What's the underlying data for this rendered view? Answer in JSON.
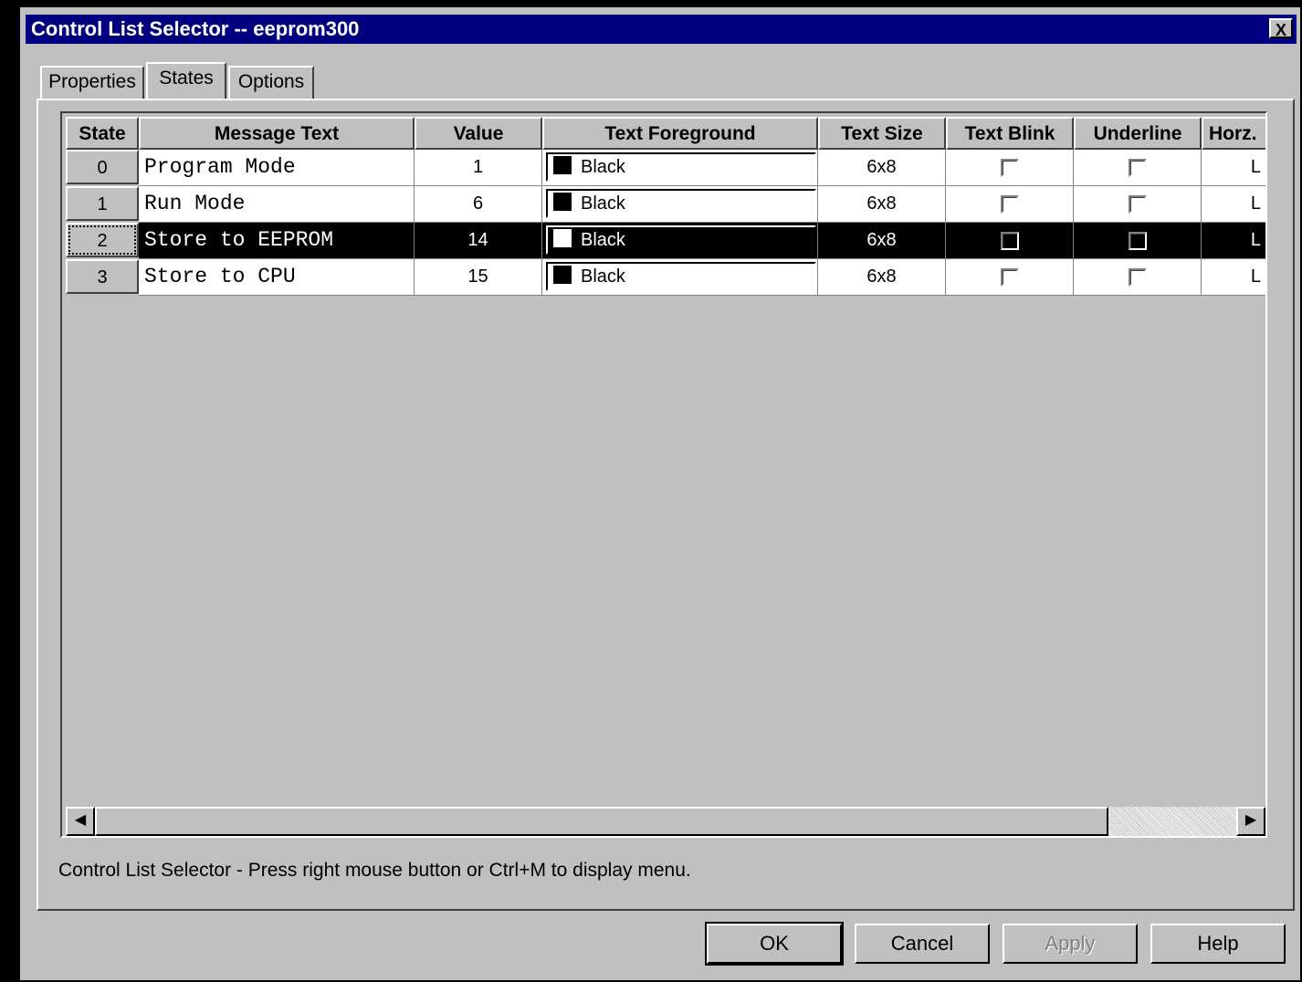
{
  "window": {
    "title": "Control List Selector -- eeprom300",
    "close_label": "X"
  },
  "tabs": [
    {
      "label": "Properties",
      "active": false
    },
    {
      "label": "States",
      "active": true
    },
    {
      "label": "Options",
      "active": false
    }
  ],
  "grid": {
    "columns": [
      "State",
      "Message Text",
      "Value",
      "Text Foreground",
      "Text Size",
      "Text Blink",
      "Underline",
      "Horz."
    ],
    "rows": [
      {
        "state": "0",
        "message": "Program Mode",
        "value": "1",
        "foreground": "Black",
        "size": "6x8",
        "blink": false,
        "underline": false,
        "horz": "L",
        "selected": false
      },
      {
        "state": "1",
        "message": "Run Mode",
        "value": "6",
        "foreground": "Black",
        "size": "6x8",
        "blink": false,
        "underline": false,
        "horz": "L",
        "selected": false
      },
      {
        "state": "2",
        "message": "Store to EEPROM",
        "value": "14",
        "foreground": "Black",
        "size": "6x8",
        "blink": false,
        "underline": false,
        "horz": "L",
        "selected": true
      },
      {
        "state": "3",
        "message": "Store to CPU",
        "value": "15",
        "foreground": "Black",
        "size": "6x8",
        "blink": false,
        "underline": false,
        "horz": "L",
        "selected": false
      }
    ],
    "scroll_left_icon": "scroll-left-arrow",
    "scroll_right_icon": "scroll-right-arrow"
  },
  "status_text": "Control List Selector - Press right mouse button or Ctrl+M to display menu.",
  "buttons": {
    "ok": "OK",
    "cancel": "Cancel",
    "apply": "Apply",
    "help": "Help"
  },
  "colors": {
    "titlebar": "#000080",
    "face": "#c0c0c0",
    "selection": "#000000"
  }
}
